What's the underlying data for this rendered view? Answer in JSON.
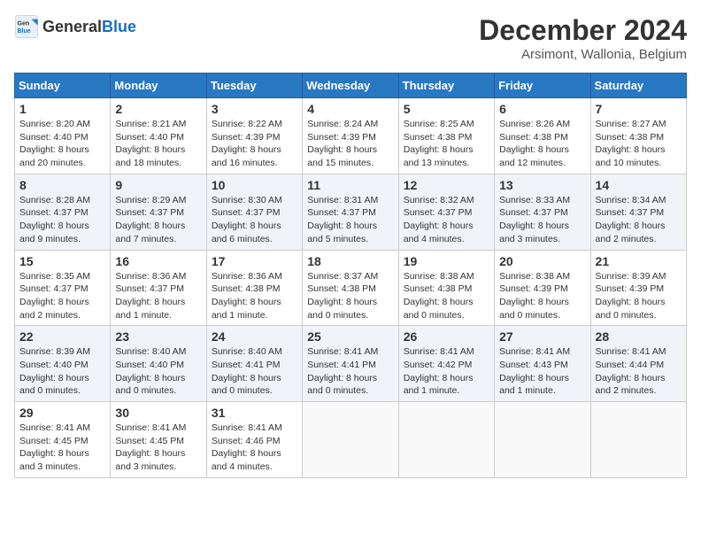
{
  "header": {
    "logo_general": "General",
    "logo_blue": "Blue",
    "month_title": "December 2024",
    "subtitle": "Arsimont, Wallonia, Belgium"
  },
  "calendar": {
    "days_of_week": [
      "Sunday",
      "Monday",
      "Tuesday",
      "Wednesday",
      "Thursday",
      "Friday",
      "Saturday"
    ],
    "weeks": [
      [
        {
          "day": "1",
          "sunrise": "8:20 AM",
          "sunset": "4:40 PM",
          "daylight": "8 hours and 20 minutes."
        },
        {
          "day": "2",
          "sunrise": "8:21 AM",
          "sunset": "4:40 PM",
          "daylight": "8 hours and 18 minutes."
        },
        {
          "day": "3",
          "sunrise": "8:22 AM",
          "sunset": "4:39 PM",
          "daylight": "8 hours and 16 minutes."
        },
        {
          "day": "4",
          "sunrise": "8:24 AM",
          "sunset": "4:39 PM",
          "daylight": "8 hours and 15 minutes."
        },
        {
          "day": "5",
          "sunrise": "8:25 AM",
          "sunset": "4:38 PM",
          "daylight": "8 hours and 13 minutes."
        },
        {
          "day": "6",
          "sunrise": "8:26 AM",
          "sunset": "4:38 PM",
          "daylight": "8 hours and 12 minutes."
        },
        {
          "day": "7",
          "sunrise": "8:27 AM",
          "sunset": "4:38 PM",
          "daylight": "8 hours and 10 minutes."
        }
      ],
      [
        {
          "day": "8",
          "sunrise": "8:28 AM",
          "sunset": "4:37 PM",
          "daylight": "8 hours and 9 minutes."
        },
        {
          "day": "9",
          "sunrise": "8:29 AM",
          "sunset": "4:37 PM",
          "daylight": "8 hours and 7 minutes."
        },
        {
          "day": "10",
          "sunrise": "8:30 AM",
          "sunset": "4:37 PM",
          "daylight": "8 hours and 6 minutes."
        },
        {
          "day": "11",
          "sunrise": "8:31 AM",
          "sunset": "4:37 PM",
          "daylight": "8 hours and 5 minutes."
        },
        {
          "day": "12",
          "sunrise": "8:32 AM",
          "sunset": "4:37 PM",
          "daylight": "8 hours and 4 minutes."
        },
        {
          "day": "13",
          "sunrise": "8:33 AM",
          "sunset": "4:37 PM",
          "daylight": "8 hours and 3 minutes."
        },
        {
          "day": "14",
          "sunrise": "8:34 AM",
          "sunset": "4:37 PM",
          "daylight": "8 hours and 2 minutes."
        }
      ],
      [
        {
          "day": "15",
          "sunrise": "8:35 AM",
          "sunset": "4:37 PM",
          "daylight": "8 hours and 2 minutes."
        },
        {
          "day": "16",
          "sunrise": "8:36 AM",
          "sunset": "4:37 PM",
          "daylight": "8 hours and 1 minute."
        },
        {
          "day": "17",
          "sunrise": "8:36 AM",
          "sunset": "4:38 PM",
          "daylight": "8 hours and 1 minute."
        },
        {
          "day": "18",
          "sunrise": "8:37 AM",
          "sunset": "4:38 PM",
          "daylight": "8 hours and 0 minutes."
        },
        {
          "day": "19",
          "sunrise": "8:38 AM",
          "sunset": "4:38 PM",
          "daylight": "8 hours and 0 minutes."
        },
        {
          "day": "20",
          "sunrise": "8:38 AM",
          "sunset": "4:39 PM",
          "daylight": "8 hours and 0 minutes."
        },
        {
          "day": "21",
          "sunrise": "8:39 AM",
          "sunset": "4:39 PM",
          "daylight": "8 hours and 0 minutes."
        }
      ],
      [
        {
          "day": "22",
          "sunrise": "8:39 AM",
          "sunset": "4:40 PM",
          "daylight": "8 hours and 0 minutes."
        },
        {
          "day": "23",
          "sunrise": "8:40 AM",
          "sunset": "4:40 PM",
          "daylight": "8 hours and 0 minutes."
        },
        {
          "day": "24",
          "sunrise": "8:40 AM",
          "sunset": "4:41 PM",
          "daylight": "8 hours and 0 minutes."
        },
        {
          "day": "25",
          "sunrise": "8:41 AM",
          "sunset": "4:41 PM",
          "daylight": "8 hours and 0 minutes."
        },
        {
          "day": "26",
          "sunrise": "8:41 AM",
          "sunset": "4:42 PM",
          "daylight": "8 hours and 1 minute."
        },
        {
          "day": "27",
          "sunrise": "8:41 AM",
          "sunset": "4:43 PM",
          "daylight": "8 hours and 1 minute."
        },
        {
          "day": "28",
          "sunrise": "8:41 AM",
          "sunset": "4:44 PM",
          "daylight": "8 hours and 2 minutes."
        }
      ],
      [
        {
          "day": "29",
          "sunrise": "8:41 AM",
          "sunset": "4:45 PM",
          "daylight": "8 hours and 3 minutes."
        },
        {
          "day": "30",
          "sunrise": "8:41 AM",
          "sunset": "4:45 PM",
          "daylight": "8 hours and 3 minutes."
        },
        {
          "day": "31",
          "sunrise": "8:41 AM",
          "sunset": "4:46 PM",
          "daylight": "8 hours and 4 minutes."
        },
        null,
        null,
        null,
        null
      ]
    ]
  }
}
